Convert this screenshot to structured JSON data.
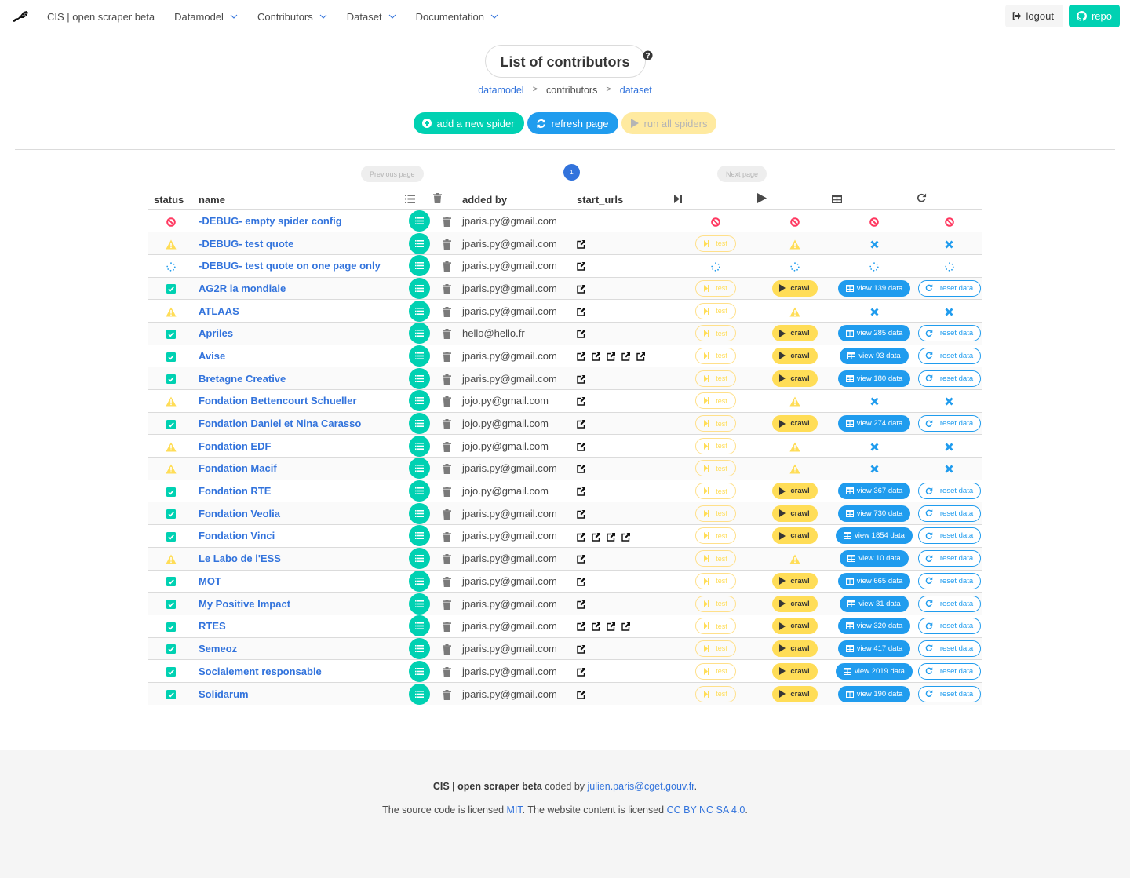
{
  "navbar": {
    "brand": "CIS | open scraper beta",
    "logo_icon": "brush-logo-icon",
    "menus": [
      {
        "label": "Datamodel"
      },
      {
        "label": "Contributors"
      },
      {
        "label": "Dataset"
      },
      {
        "label": "Documentation"
      }
    ],
    "logout_label": "logout",
    "repo_label": "repo"
  },
  "header": {
    "title": "List of contributors",
    "help_icon": "question-circle-icon",
    "breadcrumb": {
      "first": "datamodel",
      "current": "contributors",
      "last": "dataset",
      "separator": ">"
    }
  },
  "actions": {
    "add_label": "add a new spider",
    "refresh_label": "refresh page",
    "run_all_label": "run all spiders"
  },
  "pagination": {
    "previous_label": "Previous page",
    "next_label": "Next page",
    "current_page": "1"
  },
  "table": {
    "columns": {
      "status": "status",
      "name": "name",
      "added_by": "added by",
      "start_urls": "start_urls"
    },
    "labels": {
      "test": "test",
      "crawl": "crawl",
      "reset": "reset data"
    },
    "colors": {
      "primary_teal": "#00d1b2",
      "info_blue": "#209cee",
      "link_blue": "#3273dc",
      "warning_yellow": "#ffdd57",
      "danger_red": "#ff3860"
    },
    "rows": [
      {
        "status": "error",
        "name": "-DEBUG- empty spider config",
        "added_by": "jparis.py@gmail.com",
        "urls": 0,
        "state": "error",
        "view": ""
      },
      {
        "status": "warning",
        "name": "-DEBUG- test quote",
        "added_by": "jparis.py@gmail.com",
        "urls": 1,
        "state": "warning",
        "view": ""
      },
      {
        "status": "loading",
        "name": "-DEBUG- test quote on one page only",
        "added_by": "jparis.py@gmail.com",
        "urls": 1,
        "state": "loading",
        "view": ""
      },
      {
        "status": "ok",
        "name": "AG2R la mondiale",
        "added_by": "jparis.py@gmail.com",
        "urls": 1,
        "state": "ok",
        "view": "view 139 data"
      },
      {
        "status": "warning",
        "name": "ATLAAS",
        "added_by": "jparis.py@gmail.com",
        "urls": 1,
        "state": "warning",
        "view": ""
      },
      {
        "status": "ok",
        "name": "Apriles",
        "added_by": "hello@hello.fr",
        "urls": 1,
        "state": "ok",
        "view": "view 285 data"
      },
      {
        "status": "ok",
        "name": "Avise",
        "added_by": "jparis.py@gmail.com",
        "urls": 5,
        "state": "ok",
        "view": "view 93 data"
      },
      {
        "status": "ok",
        "name": "Bretagne Creative",
        "added_by": "jparis.py@gmail.com",
        "urls": 1,
        "state": "ok",
        "view": "view 180 data"
      },
      {
        "status": "warning",
        "name": "Fondation Bettencourt Schueller",
        "added_by": "jojo.py@gmail.com",
        "urls": 1,
        "state": "warning",
        "view": ""
      },
      {
        "status": "ok",
        "name": "Fondation Daniel et Nina Carasso",
        "added_by": "jojo.py@gmail.com",
        "urls": 1,
        "state": "ok",
        "view": "view 274 data"
      },
      {
        "status": "warning",
        "name": "Fondation EDF",
        "added_by": "jojo.py@gmail.com",
        "urls": 1,
        "state": "warning",
        "view": ""
      },
      {
        "status": "warning",
        "name": "Fondation Macif",
        "added_by": "jparis.py@gmail.com",
        "urls": 1,
        "state": "warning",
        "view": ""
      },
      {
        "status": "ok",
        "name": "Fondation RTE",
        "added_by": "jojo.py@gmail.com",
        "urls": 1,
        "state": "ok",
        "view": "view 367 data"
      },
      {
        "status": "ok",
        "name": "Fondation Veolia",
        "added_by": "jparis.py@gmail.com",
        "urls": 1,
        "state": "ok",
        "view": "view 730 data"
      },
      {
        "status": "ok",
        "name": "Fondation Vinci",
        "added_by": "jparis.py@gmail.com",
        "urls": 4,
        "state": "ok",
        "view": "view 1854 data"
      },
      {
        "status": "warning",
        "name": "Le Labo de l'ESS",
        "added_by": "jparis.py@gmail.com",
        "urls": 1,
        "state": "warning-data",
        "view": "view 10 data"
      },
      {
        "status": "ok",
        "name": "MOT",
        "added_by": "jparis.py@gmail.com",
        "urls": 1,
        "state": "ok",
        "view": "view 665 data"
      },
      {
        "status": "ok",
        "name": "My Positive Impact",
        "added_by": "jparis.py@gmail.com",
        "urls": 1,
        "state": "ok",
        "view": "view 31 data"
      },
      {
        "status": "ok",
        "name": "RTES",
        "added_by": "jparis.py@gmail.com",
        "urls": 4,
        "state": "ok",
        "view": "view 320 data"
      },
      {
        "status": "ok",
        "name": "Semeoz",
        "added_by": "jparis.py@gmail.com",
        "urls": 1,
        "state": "ok",
        "view": "view 417 data"
      },
      {
        "status": "ok",
        "name": "Socialement responsable",
        "added_by": "jparis.py@gmail.com",
        "urls": 1,
        "state": "ok",
        "view": "view 2019 data"
      },
      {
        "status": "ok",
        "name": "Solidarum",
        "added_by": "jparis.py@gmail.com",
        "urls": 1,
        "state": "ok",
        "view": "view 190 data"
      }
    ]
  },
  "footer": {
    "brand": "CIS | open scraper beta",
    "coded_by": " coded by ",
    "email": "julien.paris@cget.gouv.fr",
    "period": ".",
    "license_text_1": "The source code is licensed ",
    "mit": "MIT",
    "license_text_2": ". The website content is licensed ",
    "cc": "CC BY NC SA 4.0",
    "license_text_3": "."
  }
}
